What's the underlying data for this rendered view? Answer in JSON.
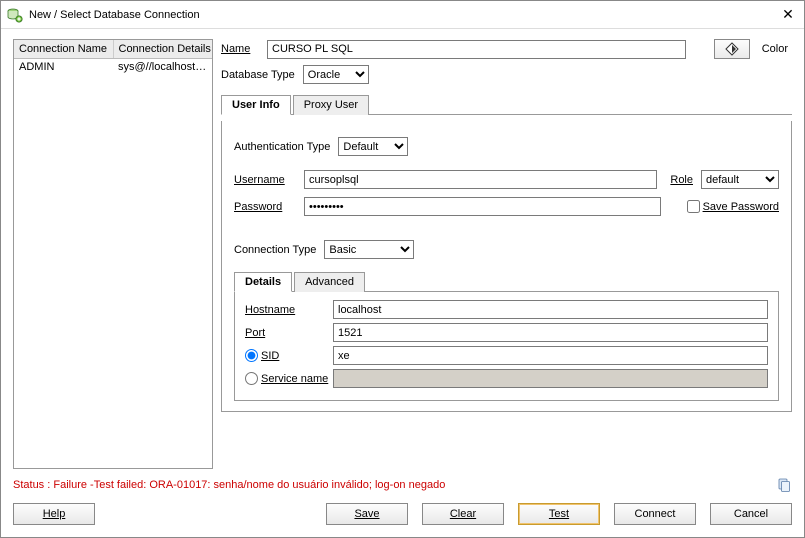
{
  "titlebar": {
    "title": "New / Select Database Connection",
    "close_symbol": "✕"
  },
  "conn_list": {
    "col1": "Connection Name",
    "col2": "Connection Details",
    "rows": [
      {
        "name": "ADMIN",
        "details": "sys@//localhost:..."
      }
    ]
  },
  "name_row": {
    "label": "Name",
    "value": "CURSO PL SQL",
    "color_label": "Color"
  },
  "db_type": {
    "label": "Database Type",
    "value": "Oracle"
  },
  "tabs_auth": {
    "user_info": "User Info",
    "proxy_user": "Proxy User"
  },
  "auth_type": {
    "label": "Authentication Type",
    "value": "Default"
  },
  "username": {
    "label": "Username",
    "value": "cursoplsql"
  },
  "password": {
    "label": "Password",
    "value": "•••••••••"
  },
  "role": {
    "label": "Role",
    "value": "default"
  },
  "save_pwd": {
    "label": "Save Password"
  },
  "conn_type": {
    "label": "Connection Type",
    "value": "Basic"
  },
  "tabs_conn": {
    "details": "Details",
    "advanced": "Advanced"
  },
  "host": {
    "label": "Hostname",
    "value": "localhost"
  },
  "port": {
    "label": "Port",
    "value": "1521"
  },
  "sid": {
    "label": "SID",
    "value": "xe"
  },
  "svc": {
    "label": "Service name",
    "value": ""
  },
  "status_text": "Status : Failure -Test failed: ORA-01017: senha/nome do usuário inválido; log-on negado",
  "buttons": {
    "help": "Help",
    "save": "Save",
    "clear": "Clear",
    "test": "Test",
    "connect": "Connect",
    "cancel": "Cancel"
  }
}
